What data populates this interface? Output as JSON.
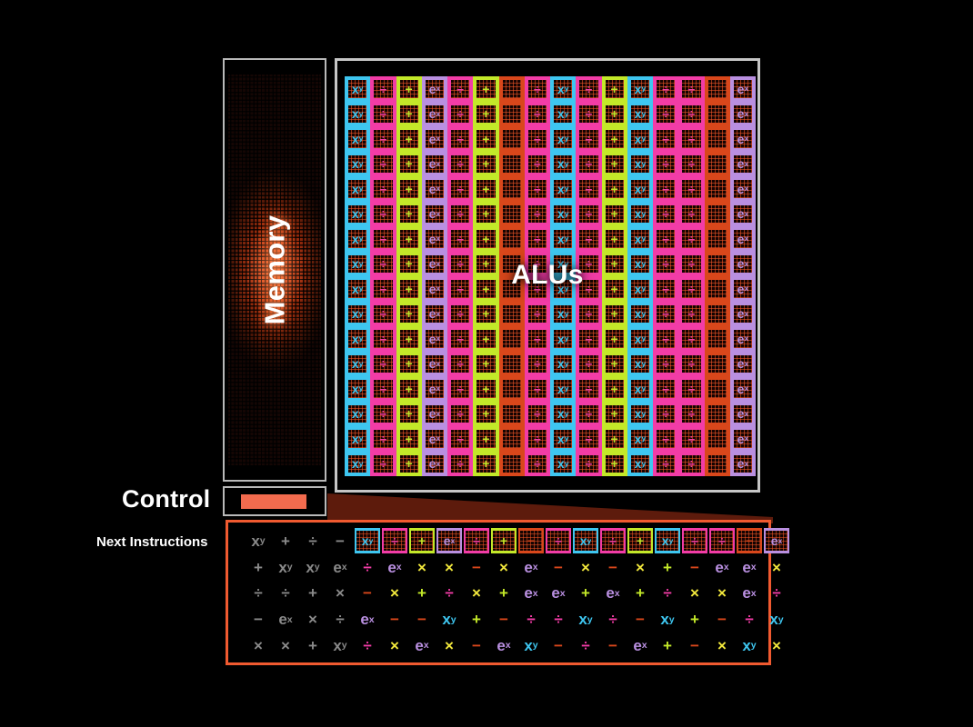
{
  "labels": {
    "memory": "Memory",
    "control": "Control",
    "alus": "ALUs",
    "next_instructions": "Next Instructions"
  },
  "colors": {
    "cyan": "#3ec6f0",
    "magenta": "#f23ca6",
    "green": "#c3e829",
    "purple": "#b98fe0",
    "orange": "#d9471b",
    "yellow": "#f2e83c",
    "gray": "#8a8a8a",
    "frame_gray": "#c6c6c6",
    "instr_border": "#f05a30",
    "control_bar": "#f26b4e",
    "wedge": "#5d1b0c",
    "background": "#000000"
  },
  "alu_grid": {
    "rows": 16,
    "cols": 16,
    "column_types": [
      {
        "symbol": "x^y",
        "color": "cyan"
      },
      {
        "symbol": "div",
        "color": "magenta"
      },
      {
        "symbol": "plus",
        "color": "green"
      },
      {
        "symbol": "e^x",
        "color": "purple"
      },
      {
        "symbol": "div",
        "color": "magenta"
      },
      {
        "symbol": "plus",
        "color": "green"
      },
      {
        "symbol": "blank",
        "color": "orange"
      },
      {
        "symbol": "div",
        "color": "magenta"
      },
      {
        "symbol": "x^y",
        "color": "cyan"
      },
      {
        "symbol": "div",
        "color": "magenta"
      },
      {
        "symbol": "plus",
        "color": "green"
      },
      {
        "symbol": "x^y",
        "color": "cyan"
      },
      {
        "symbol": "div",
        "color": "magenta"
      },
      {
        "symbol": "div",
        "color": "magenta"
      },
      {
        "symbol": "blank",
        "color": "orange"
      },
      {
        "symbol": "e^x",
        "color": "purple"
      }
    ]
  },
  "instructions": {
    "row_boxed": {
      "lead": [
        {
          "symbol": "x^y",
          "color": "gray"
        },
        {
          "symbol": "plus",
          "color": "gray"
        },
        {
          "symbol": "div",
          "color": "gray"
        },
        {
          "symbol": "minus",
          "color": "gray"
        }
      ],
      "boxes": [
        {
          "symbol": "x^y",
          "color": "cyan"
        },
        {
          "symbol": "div",
          "color": "magenta"
        },
        {
          "symbol": "plus",
          "color": "green"
        },
        {
          "symbol": "e^x",
          "color": "purple"
        },
        {
          "symbol": "div",
          "color": "magenta"
        },
        {
          "symbol": "plus",
          "color": "green"
        },
        {
          "symbol": "minus",
          "color": "orange"
        },
        {
          "symbol": "div",
          "color": "magenta"
        },
        {
          "symbol": "x^y",
          "color": "cyan"
        },
        {
          "symbol": "div",
          "color": "magenta"
        },
        {
          "symbol": "plus",
          "color": "green"
        },
        {
          "symbol": "x^y",
          "color": "cyan"
        },
        {
          "symbol": "div",
          "color": "magenta"
        },
        {
          "symbol": "div",
          "color": "magenta"
        },
        {
          "symbol": "minus",
          "color": "orange"
        },
        {
          "symbol": "e^x",
          "color": "purple"
        }
      ]
    },
    "rows": [
      [
        {
          "symbol": "plus",
          "color": "gray"
        },
        {
          "symbol": "x^y",
          "color": "gray"
        },
        {
          "symbol": "x^y",
          "color": "gray"
        },
        {
          "symbol": "e^x",
          "color": "gray"
        },
        {
          "symbol": "div",
          "color": "magenta"
        },
        {
          "symbol": "e^x",
          "color": "purple"
        },
        {
          "symbol": "times",
          "color": "yellow"
        },
        {
          "symbol": "times",
          "color": "yellow"
        },
        {
          "symbol": "minus",
          "color": "orange"
        },
        {
          "symbol": "times",
          "color": "yellow"
        },
        {
          "symbol": "e^x",
          "color": "purple"
        },
        {
          "symbol": "minus",
          "color": "orange"
        },
        {
          "symbol": "times",
          "color": "yellow"
        },
        {
          "symbol": "minus",
          "color": "orange"
        },
        {
          "symbol": "times",
          "color": "yellow"
        },
        {
          "symbol": "plus",
          "color": "green"
        },
        {
          "symbol": "minus",
          "color": "orange"
        },
        {
          "symbol": "e^x",
          "color": "purple"
        },
        {
          "symbol": "e^x",
          "color": "purple"
        },
        {
          "symbol": "times",
          "color": "yellow"
        }
      ],
      [
        {
          "symbol": "div",
          "color": "gray"
        },
        {
          "symbol": "div",
          "color": "gray"
        },
        {
          "symbol": "plus",
          "color": "gray"
        },
        {
          "symbol": "times",
          "color": "gray"
        },
        {
          "symbol": "minus",
          "color": "orange"
        },
        {
          "symbol": "times",
          "color": "yellow"
        },
        {
          "symbol": "plus",
          "color": "green"
        },
        {
          "symbol": "div",
          "color": "magenta"
        },
        {
          "symbol": "times",
          "color": "yellow"
        },
        {
          "symbol": "plus",
          "color": "green"
        },
        {
          "symbol": "e^x",
          "color": "purple"
        },
        {
          "symbol": "e^x",
          "color": "purple"
        },
        {
          "symbol": "plus",
          "color": "green"
        },
        {
          "symbol": "e^x",
          "color": "purple"
        },
        {
          "symbol": "plus",
          "color": "green"
        },
        {
          "symbol": "div",
          "color": "magenta"
        },
        {
          "symbol": "times",
          "color": "yellow"
        },
        {
          "symbol": "times",
          "color": "yellow"
        },
        {
          "symbol": "e^x",
          "color": "purple"
        },
        {
          "symbol": "div",
          "color": "magenta"
        }
      ],
      [
        {
          "symbol": "minus",
          "color": "gray"
        },
        {
          "symbol": "e^x",
          "color": "gray"
        },
        {
          "symbol": "times",
          "color": "gray"
        },
        {
          "symbol": "div",
          "color": "gray"
        },
        {
          "symbol": "e^x",
          "color": "purple"
        },
        {
          "symbol": "minus",
          "color": "orange"
        },
        {
          "symbol": "minus",
          "color": "orange"
        },
        {
          "symbol": "x^y",
          "color": "cyan"
        },
        {
          "symbol": "plus",
          "color": "green"
        },
        {
          "symbol": "minus",
          "color": "orange"
        },
        {
          "symbol": "div",
          "color": "magenta"
        },
        {
          "symbol": "div",
          "color": "magenta"
        },
        {
          "symbol": "x^y",
          "color": "cyan"
        },
        {
          "symbol": "div",
          "color": "magenta"
        },
        {
          "symbol": "minus",
          "color": "orange"
        },
        {
          "symbol": "x^y",
          "color": "cyan"
        },
        {
          "symbol": "plus",
          "color": "green"
        },
        {
          "symbol": "minus",
          "color": "orange"
        },
        {
          "symbol": "div",
          "color": "magenta"
        },
        {
          "symbol": "x^y",
          "color": "cyan"
        }
      ],
      [
        {
          "symbol": "times",
          "color": "gray"
        },
        {
          "symbol": "times",
          "color": "gray"
        },
        {
          "symbol": "plus",
          "color": "gray"
        },
        {
          "symbol": "x^y",
          "color": "gray"
        },
        {
          "symbol": "div",
          "color": "magenta"
        },
        {
          "symbol": "times",
          "color": "yellow"
        },
        {
          "symbol": "e^x",
          "color": "purple"
        },
        {
          "symbol": "times",
          "color": "yellow"
        },
        {
          "symbol": "minus",
          "color": "orange"
        },
        {
          "symbol": "e^x",
          "color": "purple"
        },
        {
          "symbol": "x^y",
          "color": "cyan"
        },
        {
          "symbol": "minus",
          "color": "orange"
        },
        {
          "symbol": "div",
          "color": "magenta"
        },
        {
          "symbol": "minus",
          "color": "orange"
        },
        {
          "symbol": "e^x",
          "color": "purple"
        },
        {
          "symbol": "plus",
          "color": "green"
        },
        {
          "symbol": "minus",
          "color": "orange"
        },
        {
          "symbol": "times",
          "color": "yellow"
        },
        {
          "symbol": "x^y",
          "color": "cyan"
        },
        {
          "symbol": "times",
          "color": "yellow"
        }
      ]
    ]
  }
}
